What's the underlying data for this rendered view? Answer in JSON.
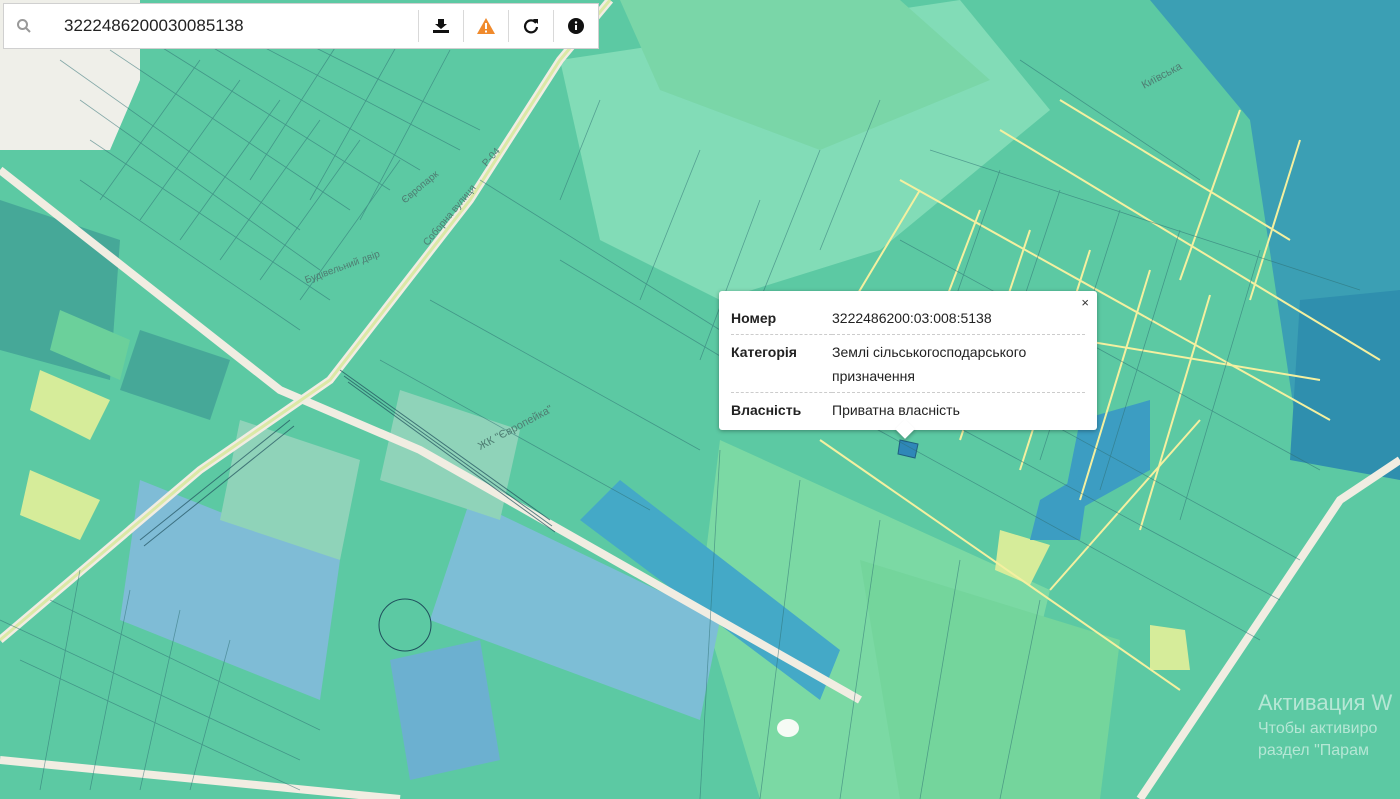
{
  "search": {
    "value": "3222486200030085138",
    "placeholder": ""
  },
  "toolbar": {
    "icons": [
      "search-icon",
      "download-icon",
      "warning-icon",
      "refresh-icon",
      "info-icon"
    ]
  },
  "popup": {
    "close": "×",
    "rows": [
      {
        "key": "Номер",
        "value": "3222486200:03:008:5138"
      },
      {
        "key": "Категорія",
        "value": "Землі сільськогосподарського призначення"
      },
      {
        "key": "Власність",
        "value": "Приватна власність"
      }
    ]
  },
  "map_labels": {
    "road": "Р-04",
    "park": "Європарк",
    "zhk": "ЖК \"Європейка\"",
    "street1": "Соборна вулиця",
    "street2": "Київська",
    "place": "Будівельний двір"
  },
  "watermark": {
    "line1": "Активация W",
    "line2": "Чтобы активиро",
    "line3": "раздел \"Парам"
  },
  "colors": {
    "parcel_green": "#7fdcb0",
    "parcel_teal": "#5cc9a3",
    "parcel_blue": "#4ba7c7",
    "parcel_lightblue": "#8fc3d6",
    "parcel_yellow": "#d6ec9a",
    "line_yellow": "#f4f0a0",
    "road": "#f1ede2",
    "warning": "#f08a2c"
  }
}
